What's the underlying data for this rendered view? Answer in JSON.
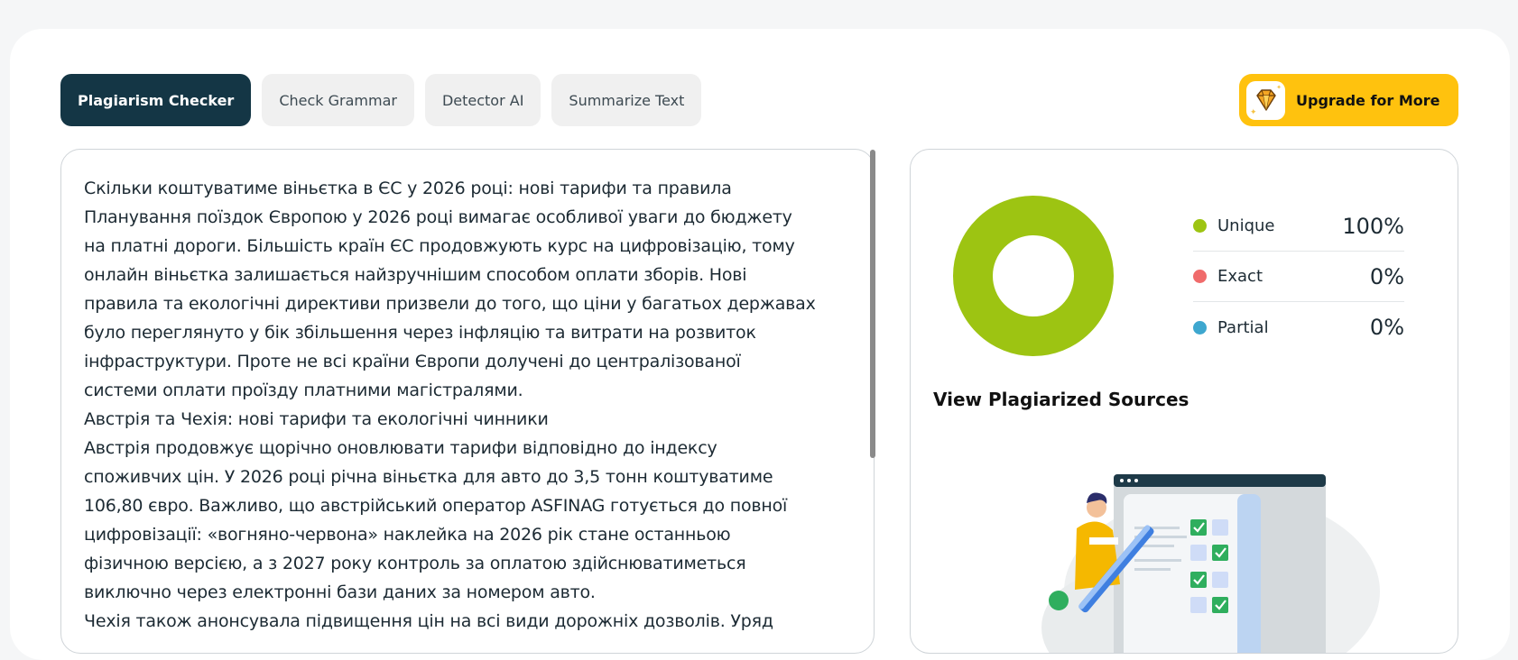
{
  "tabs": [
    {
      "label": "Plagiarism Checker",
      "active": true
    },
    {
      "label": "Check Grammar",
      "active": false
    },
    {
      "label": "Detector AI",
      "active": false
    },
    {
      "label": "Summarize Text",
      "active": false
    }
  ],
  "upgrade": {
    "label": "Upgrade for More",
    "icon": "diamond-icon"
  },
  "editor": {
    "lines": [
      "Скільки коштуватиме віньєтка в ЄС у 2026 році: нові тарифи та правила",
      "Планування поїздок Європою у 2026 році вимагає особливої уваги до бюджету",
      "на платні дороги. Більшість країн ЄС продовжують курс на цифровізацію, тому",
      "онлайн віньєтка залишається найзручнішим способом оплати зборів. Нові",
      "правила та екологічні директиви призвели до того, що ціни у багатьох державах",
      "було переглянуто у бік збільшення через інфляцію та витрати на розвиток",
      "інфраструктури. Проте не всі країни Європи долучені до централізованої",
      "системи оплати проїзду платними магістралями.",
      "Австрія та Чехія: нові тарифи та екологічні чинники",
      "Австрія продовжує щорічно оновлювати тарифи відповідно до індексу",
      "споживчих цін. У 2026 році річна віньєтка для авто до 3,5 тонн коштуватиме",
      "106,80 євро. Важливо, що австрійський оператор ASFINAG готується до повної",
      "цифровізації: «вогняно-червона» наклейка на 2026 рік стане останньою",
      "фізичною версією, а з 2027 року контроль за оплатою здійснюватиметься",
      "виключно через електронні бази даних за номером авто.",
      "Чехія також анонсувала підвищення цін на всі види дорожніх дозволів. Уряд"
    ]
  },
  "results": {
    "legend": [
      {
        "label": "Unique",
        "value": "100%",
        "fraction": 1.0,
        "color": "#9dc412"
      },
      {
        "label": "Exact",
        "value": "0%",
        "fraction": 0.0,
        "color": "#f06b6b"
      },
      {
        "label": "Partial",
        "value": "0%",
        "fraction": 0.0,
        "color": "#3ea7cf"
      }
    ],
    "sources_title": "View Plagiarized Sources"
  },
  "colors": {
    "primary_dark": "#143645",
    "accent_yellow": "#ffc20e",
    "unique_green": "#9dc412"
  }
}
